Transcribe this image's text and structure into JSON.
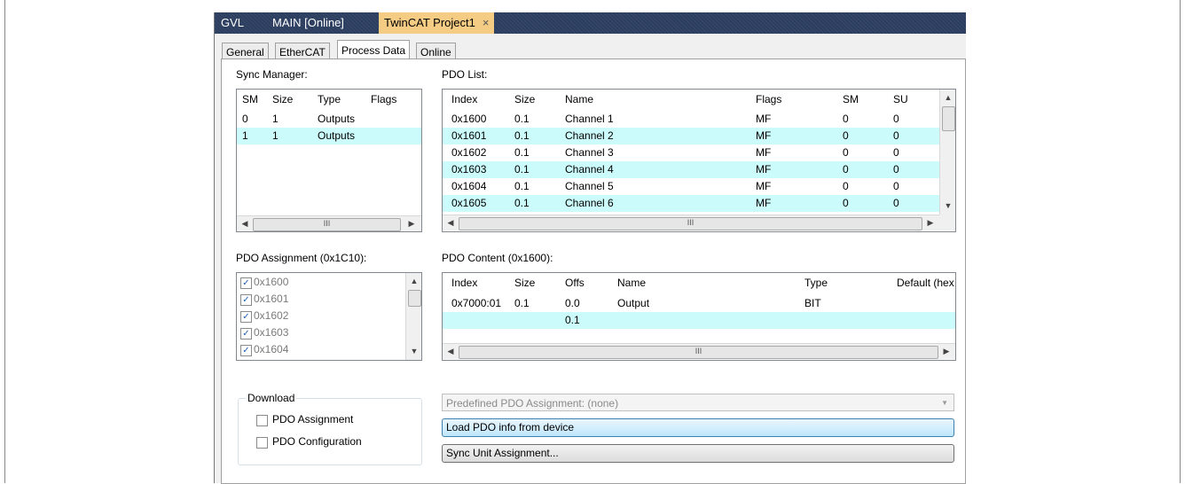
{
  "doc_tabs": [
    {
      "label": "GVL"
    },
    {
      "label": "MAIN [Online]"
    },
    {
      "label": "TwinCAT Project1",
      "close": "×"
    }
  ],
  "inner_tabs": [
    "General",
    "EtherCAT",
    "Process Data",
    "Online"
  ],
  "sync_manager": {
    "label": "Sync Manager:",
    "columns": [
      "SM",
      "Size",
      "Type",
      "Flags"
    ],
    "rows": [
      {
        "sm": "0",
        "size": "1",
        "type": "Outputs",
        "flags": ""
      },
      {
        "sm": "1",
        "size": "1",
        "type": "Outputs",
        "flags": ""
      }
    ]
  },
  "pdo_list": {
    "label": "PDO List:",
    "columns": [
      "Index",
      "Size",
      "Name",
      "Flags",
      "SM",
      "SU"
    ],
    "rows": [
      {
        "index": "0x1600",
        "size": "0.1",
        "name": "Channel 1",
        "flags": "MF",
        "sm": "0",
        "su": "0"
      },
      {
        "index": "0x1601",
        "size": "0.1",
        "name": "Channel 2",
        "flags": "MF",
        "sm": "0",
        "su": "0"
      },
      {
        "index": "0x1602",
        "size": "0.1",
        "name": "Channel 3",
        "flags": "MF",
        "sm": "0",
        "su": "0"
      },
      {
        "index": "0x1603",
        "size": "0.1",
        "name": "Channel 4",
        "flags": "MF",
        "sm": "0",
        "su": "0"
      },
      {
        "index": "0x1604",
        "size": "0.1",
        "name": "Channel 5",
        "flags": "MF",
        "sm": "0",
        "su": "0"
      },
      {
        "index": "0x1605",
        "size": "0.1",
        "name": "Channel 6",
        "flags": "MF",
        "sm": "0",
        "su": "0"
      }
    ]
  },
  "pdo_assignment": {
    "label": "PDO Assignment (0x1C10):",
    "items": [
      "0x1600",
      "0x1601",
      "0x1602",
      "0x1603",
      "0x1604"
    ]
  },
  "pdo_content": {
    "label": "PDO Content (0x1600):",
    "columns": [
      "Index",
      "Size",
      "Offs",
      "Name",
      "Type",
      "Default (hex"
    ],
    "rows": [
      {
        "index": "0x7000:01",
        "size": "0.1",
        "offs": "0.0",
        "name": "Output",
        "type": "BIT",
        "default": ""
      },
      {
        "index": "",
        "size": "",
        "offs": "0.1",
        "name": "",
        "type": "",
        "default": ""
      }
    ]
  },
  "download": {
    "title": "Download",
    "options": [
      "PDO Assignment",
      "PDO Configuration"
    ]
  },
  "predefined": {
    "value": "Predefined PDO Assignment: (none)"
  },
  "buttons": {
    "load": "Load PDO info from device",
    "sync_unit": "Sync Unit Assignment..."
  },
  "scroll_glyph": "III",
  "icons": {
    "check": "✓",
    "left": "◀",
    "right": "▶",
    "up": "▲",
    "down": "▼"
  },
  "colors": {
    "doc_tab_bg": "#2c3e60",
    "active_doc_tab": "#f5cc84",
    "row_highlight": "#ccfbfb"
  }
}
